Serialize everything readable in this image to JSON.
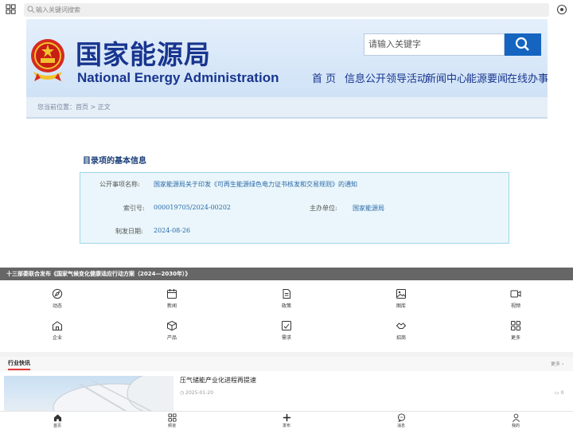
{
  "topbar": {
    "search_placeholder": "输入关键词搜索",
    "left_icon": "grid-icon",
    "right_icon": "scan-icon"
  },
  "hero": {
    "title_cn": "国家能源局",
    "title_en": "National Energy Administration",
    "search_placeholder": "请输入关键字",
    "nav": [
      "首 页",
      "信息公开",
      "领导活动",
      "新闻中心",
      "能源要闻",
      "在线办事"
    ],
    "breadcrumb": "您当前位置：首页 > 正文",
    "doc_heading": "目录项的基本信息",
    "doc_info": {
      "title_label": "公开事项名称:",
      "title_value": "国家能源局关于印发《可再生能源绿色电力证书核发和交易规则》的通知",
      "index_label": "索引号:",
      "index_value": "000019705/2024-00202",
      "org_label": "主办单位:",
      "org_value": "国家能源局",
      "date_label": "制发日期:",
      "date_value": "2024-08-26"
    }
  },
  "ticker": {
    "text": "十三部委联合发布《国家气候变化健康适应行动方案（2024—2030年）》"
  },
  "quick_links": [
    {
      "label": "动态",
      "icon": "compass-icon"
    },
    {
      "label": "新闻",
      "icon": "calendar-icon"
    },
    {
      "label": "政策",
      "icon": "document-icon"
    },
    {
      "label": "图库",
      "icon": "image-icon"
    },
    {
      "label": "视频",
      "icon": "video-icon"
    },
    {
      "label": "企业",
      "icon": "building-icon"
    },
    {
      "label": "产品",
      "icon": "cube-icon"
    },
    {
      "label": "需求",
      "icon": "request-icon"
    },
    {
      "label": "招商",
      "icon": "handshake-icon"
    },
    {
      "label": "更多",
      "icon": "more-grid-icon"
    }
  ],
  "news": {
    "section_title": "行业快讯",
    "more_label": "更多",
    "items": [
      {
        "headline": "压气储能产业化进程再提速",
        "date": "2025-01-20",
        "comments": "0"
      }
    ]
  },
  "tabbar": [
    {
      "label": "首页",
      "icon": "home-icon"
    },
    {
      "label": "频道",
      "icon": "channel-icon"
    },
    {
      "label": "发布",
      "icon": "plus-icon"
    },
    {
      "label": "消息",
      "icon": "message-icon"
    },
    {
      "label": "我的",
      "icon": "user-icon"
    }
  ],
  "colors": {
    "brand_blue": "#18358f",
    "search_button": "#1565c0",
    "ticker_bg": "#666666",
    "accent_red": "#e53935"
  }
}
